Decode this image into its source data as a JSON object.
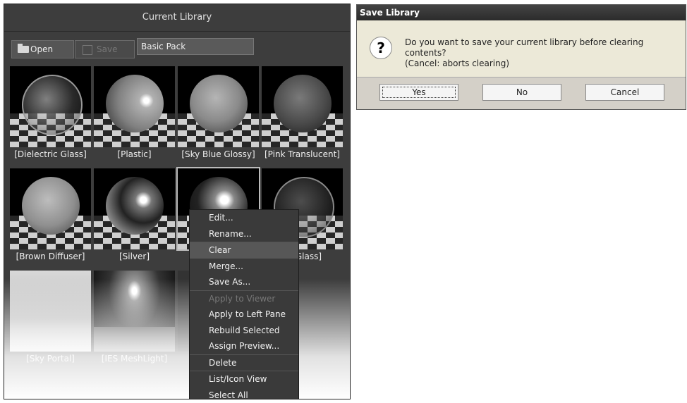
{
  "library": {
    "title": "Current Library",
    "open_label": "Open",
    "save_label": "Save",
    "library_name": "Basic Pack",
    "items": [
      {
        "label": "[Dielectric Glass]"
      },
      {
        "label": "[Plastic]"
      },
      {
        "label": "[Sky Blue Glossy]"
      },
      {
        "label": "[Pink Translucent]"
      },
      {
        "label": "[Brown Diffuser]"
      },
      {
        "label": "[Silver]"
      },
      {
        "label": ""
      },
      {
        "label": "Glass]"
      },
      {
        "label": "[Sky Portal]"
      },
      {
        "label": "[IES MeshLight]"
      }
    ]
  },
  "context_menu": {
    "items": [
      {
        "label": "Edit...",
        "enabled": true
      },
      {
        "label": "Rename...",
        "enabled": true
      },
      {
        "label": "Clear",
        "enabled": true,
        "highlighted": true
      },
      {
        "label": "Merge...",
        "enabled": true
      },
      {
        "label": "Save As...",
        "enabled": true
      },
      {
        "label": "Apply to Viewer",
        "enabled": false
      },
      {
        "label": "Apply to Left Pane",
        "enabled": true
      },
      {
        "label": "Rebuild Selected",
        "enabled": true
      },
      {
        "label": "Assign Preview...",
        "enabled": true
      },
      {
        "label": "Delete",
        "enabled": true
      },
      {
        "label": "List/Icon View",
        "enabled": true
      },
      {
        "label": "Select All",
        "enabled": true
      }
    ]
  },
  "dialog": {
    "title": "Save Library",
    "message_line1": "Do you want to save your current library before clearing contents?",
    "message_line2": "(Cancel: aborts clearing)",
    "yes_label": "Yes",
    "no_label": "No",
    "cancel_label": "Cancel",
    "icon": "question-icon"
  }
}
